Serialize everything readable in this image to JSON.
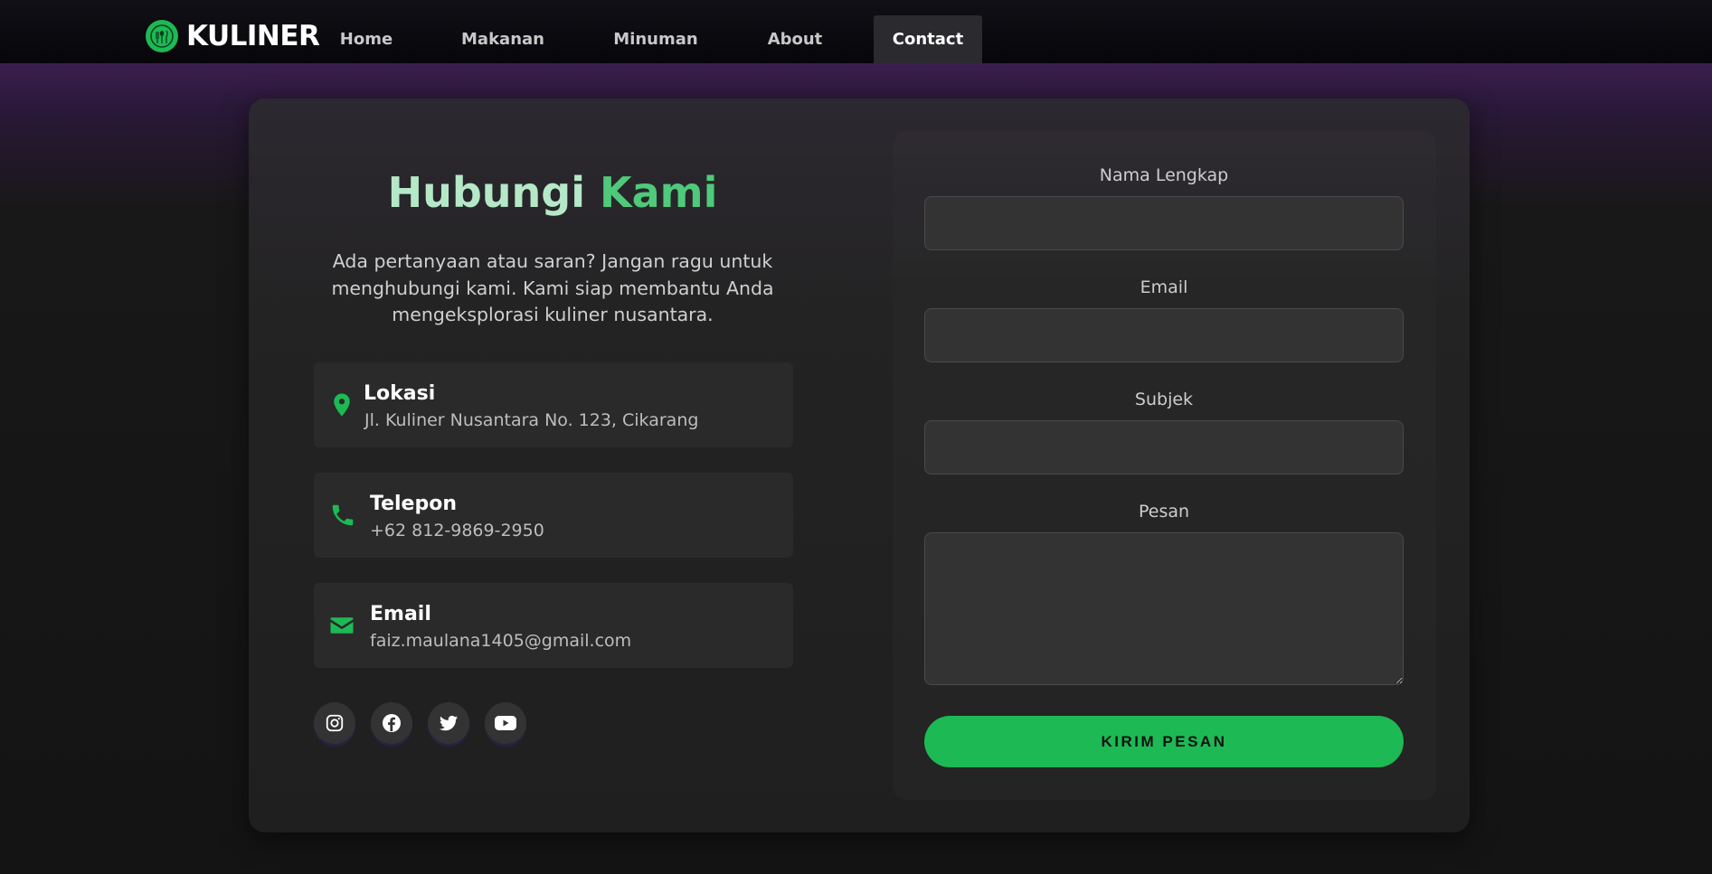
{
  "nav": {
    "brand": "KULINER",
    "items": [
      {
        "label": "Home"
      },
      {
        "label": "Makanan"
      },
      {
        "label": "Minuman"
      },
      {
        "label": "About"
      },
      {
        "label": "Contact"
      }
    ]
  },
  "contact": {
    "title_part1": "Hubungi",
    "title_part2": "Kami",
    "description": "Ada pertanyaan atau saran? Jangan ragu untuk menghubungi kami. Kami siap membantu Anda mengeksplorasi kuliner nusantara.",
    "info": [
      {
        "label": "Lokasi",
        "value": "Jl. Kuliner Nusantara No. 123, Cikarang",
        "icon": "location-pin-icon"
      },
      {
        "label": "Telepon",
        "value": "+62 812-9869-2950",
        "icon": "phone-icon"
      },
      {
        "label": "Email",
        "value": "faiz.maulana1405@gmail.com",
        "icon": "envelope-icon"
      }
    ],
    "social": [
      "instagram-icon",
      "facebook-icon",
      "twitter-icon",
      "youtube-icon"
    ]
  },
  "form": {
    "name_label": "Nama Lengkap",
    "name_value": "",
    "email_label": "Email",
    "email_value": "",
    "subject_label": "Subjek",
    "subject_value": "",
    "message_label": "Pesan",
    "message_value": "",
    "submit_label": "KIRIM PESAN"
  },
  "colors": {
    "accent": "#1db954",
    "title_light": "#b5e8c7",
    "title_green": "#4fc97a",
    "background": "#141414",
    "header_purple": "#3a1f4f"
  }
}
